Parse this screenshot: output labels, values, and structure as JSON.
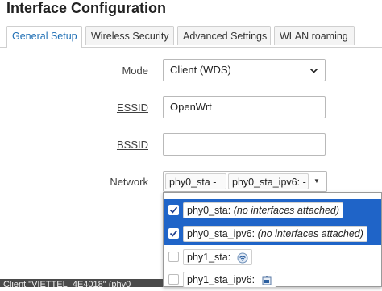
{
  "section_title": "Interface Configuration",
  "tabs": [
    {
      "label": "General Setup"
    },
    {
      "label": "Wireless Security"
    },
    {
      "label": "Advanced Settings"
    },
    {
      "label": "WLAN roaming"
    }
  ],
  "form": {
    "mode": {
      "label": "Mode",
      "value": "Client (WDS)"
    },
    "essid": {
      "label": "ESSID",
      "value": "OpenWrt"
    },
    "bssid": {
      "label": "BSSID",
      "value": ""
    },
    "network": {
      "label": "Network",
      "selected_chips": [
        {
          "name": "phy0_sta",
          "suffix": "-"
        },
        {
          "name": "phy0_sta_ipv6:",
          "suffix": "-"
        }
      ],
      "options": [
        {
          "name": "phy0_sta:",
          "note": "(no interfaces attached)",
          "checked": true
        },
        {
          "name": "phy0_sta_ipv6:",
          "note": "(no interfaces attached)",
          "checked": true
        },
        {
          "name": "phy1_sta:",
          "note": "",
          "checked": false,
          "icon": "wifi-icon"
        },
        {
          "name": "phy1_sta_ipv6:",
          "note": "",
          "checked": false,
          "icon": "ethernet-icon"
        }
      ]
    }
  },
  "status_bar": {
    "text": "Client \"VIETTEL_4E4018\" (phy0"
  },
  "colors": {
    "accent": "#1f6fb5",
    "selected_row": "#1f64c8"
  }
}
